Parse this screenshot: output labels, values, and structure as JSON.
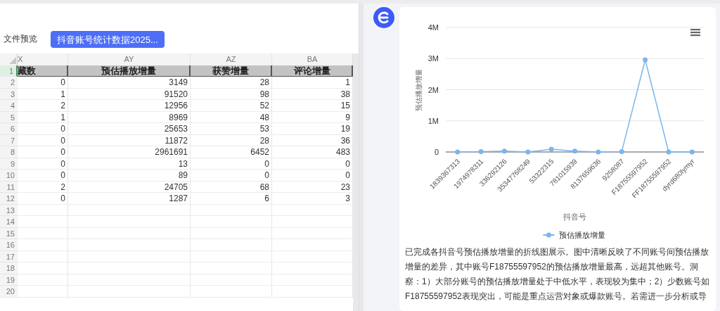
{
  "left_panel": {
    "title": "文件预览",
    "file_button": "抖音账号统计数据2025...",
    "sheet": {
      "columns": [
        "X",
        "AY",
        "AZ",
        "BA"
      ],
      "header_row": {
        "number": "1",
        "cells": [
          "藏数",
          "预估播放增量",
          "获赞增量",
          "评论增量"
        ]
      },
      "rows": [
        {
          "number": "2",
          "cells": [
            "0",
            "3149",
            "28",
            "1"
          ]
        },
        {
          "number": "3",
          "cells": [
            "1",
            "91520",
            "98",
            "38"
          ]
        },
        {
          "number": "4",
          "cells": [
            "2",
            "12956",
            "52",
            "15"
          ]
        },
        {
          "number": "5",
          "cells": [
            "1",
            "8969",
            "48",
            "9"
          ]
        },
        {
          "number": "6",
          "cells": [
            "0",
            "25653",
            "53",
            "19"
          ]
        },
        {
          "number": "7",
          "cells": [
            "0",
            "11872",
            "28",
            "36"
          ]
        },
        {
          "number": "8",
          "cells": [
            "0",
            "2961691",
            "6452",
            "483"
          ]
        },
        {
          "number": "9",
          "cells": [
            "0",
            "13",
            "0",
            "0"
          ]
        },
        {
          "number": "10",
          "cells": [
            "0",
            "89",
            "0",
            "0"
          ]
        },
        {
          "number": "11",
          "cells": [
            "2",
            "24705",
            "68",
            "23"
          ]
        },
        {
          "number": "12",
          "cells": [
            "0",
            "1287",
            "6",
            "3"
          ]
        },
        {
          "number": "13",
          "cells": []
        },
        {
          "number": "14",
          "cells": []
        },
        {
          "number": "15",
          "cells": []
        },
        {
          "number": "16",
          "cells": []
        },
        {
          "number": "17",
          "cells": []
        },
        {
          "number": "18",
          "cells": []
        },
        {
          "number": "19",
          "cells": []
        },
        {
          "number": "20",
          "cells": []
        }
      ]
    }
  },
  "right_panel": {
    "chart_data": {
      "type": "line",
      "xlabel": "抖音号",
      "ylabel": "预估播放增量",
      "categories": [
        "1839367313",
        "1974978311",
        "336292126",
        "35347768249",
        "53322315",
        "781015939",
        "8137659636",
        "9258087",
        "F18755597952",
        "FF18755597952",
        "dyrd680lymyr"
      ],
      "grid": true,
      "series": [
        {
          "name": "预估播放增量",
          "color": "#7cb5ec",
          "marker": true,
          "values": [
            0,
            10000,
            30000,
            0,
            90000,
            30000,
            0,
            10000,
            2960000,
            0,
            0
          ]
        }
      ],
      "ylim": [
        0,
        4000000
      ],
      "yticks": [
        {
          "value": 0,
          "label": "0"
        },
        {
          "value": 1000000,
          "label": "1M"
        },
        {
          "value": 2000000,
          "label": "2M"
        },
        {
          "value": 3000000,
          "label": "3M"
        },
        {
          "value": 4000000,
          "label": "4M"
        }
      ]
    },
    "message": "已完成各抖音号预估播放增量的折线图展示。图中清晰反映了不同账号间预估播放增量的差异，其中账号F18755597952的预估播放增量最高，远超其他账号。洞察：1）大部分账号的预估播放增量处于中低水平，表现较为集中；2）少数账号如F18755597952表现突出，可能是重点运营对象或爆款账号。若需进一步分析或导"
  }
}
